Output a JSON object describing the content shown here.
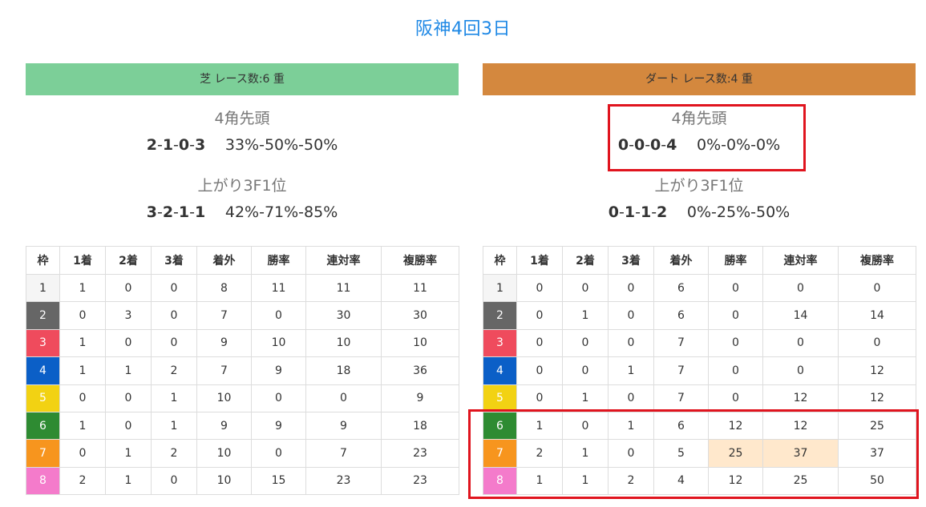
{
  "page": {
    "title": "阪神4回3日"
  },
  "colors": {
    "title": "#1e88e5",
    "turf_header": "#7ccf98",
    "dirt_header": "#d4883e",
    "highlight_cell": "#ffe8cc",
    "annotation_box": "#e0141e"
  },
  "columns": [
    "枠",
    "1着",
    "2着",
    "3着",
    "着外",
    "勝率",
    "連対率",
    "複勝率"
  ],
  "waku_colors": [
    "#f5f5f5",
    "#666666",
    "#ef4b5d",
    "#0b5fc7",
    "#f2d213",
    "#2e8b32",
    "#f7951e",
    "#f47bcb"
  ],
  "turf": {
    "header": "芝 レース数:6 重",
    "corner": {
      "label": "4角先頭",
      "record": [
        "2",
        "1",
        "0",
        "3"
      ],
      "rates": "33%-50%-50%"
    },
    "last3f": {
      "label": "上がり3F1位",
      "record": [
        "3",
        "2",
        "1",
        "1"
      ],
      "rates": "42%-71%-85%"
    },
    "rows": [
      [
        "1",
        "1",
        "0",
        "0",
        "8",
        "11",
        "11",
        "11"
      ],
      [
        "2",
        "0",
        "3",
        "0",
        "7",
        "0",
        "30",
        "30"
      ],
      [
        "3",
        "1",
        "0",
        "0",
        "9",
        "10",
        "10",
        "10"
      ],
      [
        "4",
        "1",
        "1",
        "2",
        "7",
        "9",
        "18",
        "36"
      ],
      [
        "5",
        "0",
        "0",
        "1",
        "10",
        "0",
        "0",
        "9"
      ],
      [
        "6",
        "1",
        "0",
        "1",
        "9",
        "9",
        "9",
        "18"
      ],
      [
        "7",
        "0",
        "1",
        "2",
        "10",
        "0",
        "7",
        "23"
      ],
      [
        "8",
        "2",
        "1",
        "0",
        "10",
        "15",
        "23",
        "23"
      ]
    ]
  },
  "dirt": {
    "header": "ダート レース数:4 重",
    "corner": {
      "label": "4角先頭",
      "record": [
        "0",
        "0",
        "0",
        "4"
      ],
      "rates": "0%-0%-0%"
    },
    "last3f": {
      "label": "上がり3F1位",
      "record": [
        "0",
        "1",
        "1",
        "2"
      ],
      "rates": "0%-25%-50%"
    },
    "rows": [
      [
        "1",
        "0",
        "0",
        "0",
        "6",
        "0",
        "0",
        "0"
      ],
      [
        "2",
        "0",
        "1",
        "0",
        "6",
        "0",
        "14",
        "14"
      ],
      [
        "3",
        "0",
        "0",
        "0",
        "7",
        "0",
        "0",
        "0"
      ],
      [
        "4",
        "0",
        "0",
        "1",
        "7",
        "0",
        "0",
        "12"
      ],
      [
        "5",
        "0",
        "1",
        "0",
        "7",
        "0",
        "12",
        "12"
      ],
      [
        "6",
        "1",
        "0",
        "1",
        "6",
        "12",
        "12",
        "25"
      ],
      [
        "7",
        "2",
        "1",
        "0",
        "5",
        "25",
        "37",
        "37"
      ],
      [
        "8",
        "1",
        "1",
        "2",
        "4",
        "12",
        "25",
        "50"
      ]
    ]
  }
}
